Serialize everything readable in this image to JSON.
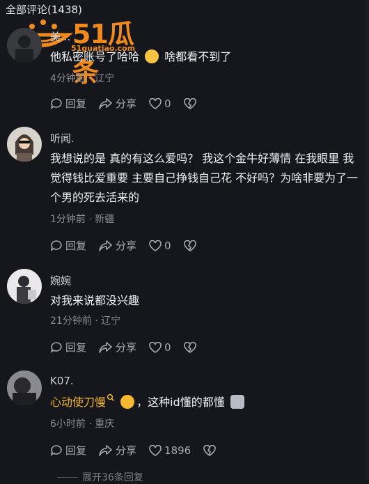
{
  "header": {
    "title": "全部评论(1438)"
  },
  "watermark": {
    "brand": "51瓜条",
    "url": "51guatiao.com"
  },
  "comments": [
    {
      "name": "美...",
      "text": "他私密账号了哈哈",
      "text_after": "啥都看不到了",
      "time": "4分钟前",
      "location": "辽宁",
      "reply_label": "回复",
      "share_label": "分享",
      "likes": "0"
    },
    {
      "name": "听闻.",
      "text": "我想说的是  真的有这么爱吗？ 我这个金牛好薄情  在我眼里  我觉得钱比爱重要  主要自己挣钱自己花  不好吗？为啥非要为了一个男的死去活来的",
      "time": "1分钟前",
      "location": "新疆",
      "reply_label": "回复",
      "share_label": "分享",
      "likes": "0"
    },
    {
      "name": "婉婉",
      "text": "对我来说都没兴趣",
      "time": "21分钟前",
      "location": "辽宁",
      "reply_label": "回复",
      "share_label": "分享",
      "likes": "0"
    },
    {
      "name": "K07.",
      "mention": "心动使刀慢",
      "text": "，这种id懂的都懂",
      "time": "6小时前",
      "location": "重庆",
      "reply_label": "回复",
      "share_label": "分享",
      "likes": "1896"
    }
  ],
  "footer": {
    "expand_label": "展开36条回复"
  },
  "colors": {
    "background": "#16171d",
    "mention": "#f2b632",
    "watermark": "#f08a1e"
  }
}
